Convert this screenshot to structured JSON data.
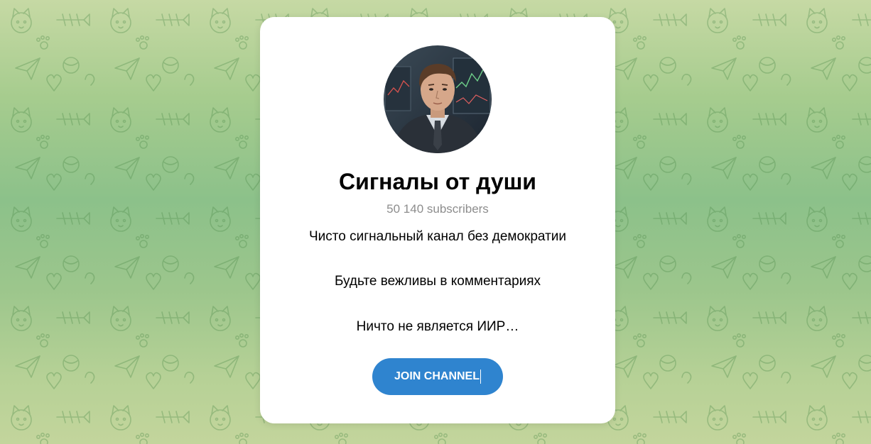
{
  "channel": {
    "title": "Сигналы от души",
    "subscribers": "50 140 subscribers",
    "description_lines": [
      "Чисто сигнальный канал без демократии",
      "Будьте вежливы в комментариях",
      "Ничто не является ИИР…"
    ]
  },
  "join_button": {
    "label": "JOIN CHANNEL"
  },
  "colors": {
    "accent": "#2f84cf",
    "background_green": "#9cc68c",
    "pattern": "#5e9a5a"
  },
  "icons": {
    "background": "doodle-pattern",
    "avatar": "channel-avatar"
  }
}
